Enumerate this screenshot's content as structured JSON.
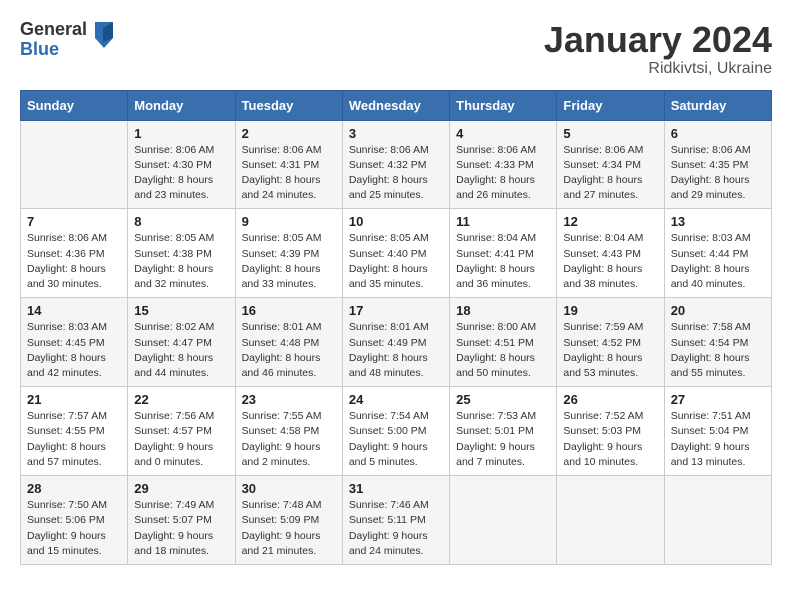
{
  "header": {
    "logo_general": "General",
    "logo_blue": "Blue",
    "title": "January 2024",
    "subtitle": "Ridkivtsi, Ukraine"
  },
  "days_of_week": [
    "Sunday",
    "Monday",
    "Tuesday",
    "Wednesday",
    "Thursday",
    "Friday",
    "Saturday"
  ],
  "weeks": [
    [
      {
        "day": "",
        "sunrise": "",
        "sunset": "",
        "daylight": ""
      },
      {
        "day": "1",
        "sunrise": "Sunrise: 8:06 AM",
        "sunset": "Sunset: 4:30 PM",
        "daylight": "Daylight: 8 hours and 23 minutes."
      },
      {
        "day": "2",
        "sunrise": "Sunrise: 8:06 AM",
        "sunset": "Sunset: 4:31 PM",
        "daylight": "Daylight: 8 hours and 24 minutes."
      },
      {
        "day": "3",
        "sunrise": "Sunrise: 8:06 AM",
        "sunset": "Sunset: 4:32 PM",
        "daylight": "Daylight: 8 hours and 25 minutes."
      },
      {
        "day": "4",
        "sunrise": "Sunrise: 8:06 AM",
        "sunset": "Sunset: 4:33 PM",
        "daylight": "Daylight: 8 hours and 26 minutes."
      },
      {
        "day": "5",
        "sunrise": "Sunrise: 8:06 AM",
        "sunset": "Sunset: 4:34 PM",
        "daylight": "Daylight: 8 hours and 27 minutes."
      },
      {
        "day": "6",
        "sunrise": "Sunrise: 8:06 AM",
        "sunset": "Sunset: 4:35 PM",
        "daylight": "Daylight: 8 hours and 29 minutes."
      }
    ],
    [
      {
        "day": "7",
        "sunrise": "Sunrise: 8:06 AM",
        "sunset": "Sunset: 4:36 PM",
        "daylight": "Daylight: 8 hours and 30 minutes."
      },
      {
        "day": "8",
        "sunrise": "Sunrise: 8:05 AM",
        "sunset": "Sunset: 4:38 PM",
        "daylight": "Daylight: 8 hours and 32 minutes."
      },
      {
        "day": "9",
        "sunrise": "Sunrise: 8:05 AM",
        "sunset": "Sunset: 4:39 PM",
        "daylight": "Daylight: 8 hours and 33 minutes."
      },
      {
        "day": "10",
        "sunrise": "Sunrise: 8:05 AM",
        "sunset": "Sunset: 4:40 PM",
        "daylight": "Daylight: 8 hours and 35 minutes."
      },
      {
        "day": "11",
        "sunrise": "Sunrise: 8:04 AM",
        "sunset": "Sunset: 4:41 PM",
        "daylight": "Daylight: 8 hours and 36 minutes."
      },
      {
        "day": "12",
        "sunrise": "Sunrise: 8:04 AM",
        "sunset": "Sunset: 4:43 PM",
        "daylight": "Daylight: 8 hours and 38 minutes."
      },
      {
        "day": "13",
        "sunrise": "Sunrise: 8:03 AM",
        "sunset": "Sunset: 4:44 PM",
        "daylight": "Daylight: 8 hours and 40 minutes."
      }
    ],
    [
      {
        "day": "14",
        "sunrise": "Sunrise: 8:03 AM",
        "sunset": "Sunset: 4:45 PM",
        "daylight": "Daylight: 8 hours and 42 minutes."
      },
      {
        "day": "15",
        "sunrise": "Sunrise: 8:02 AM",
        "sunset": "Sunset: 4:47 PM",
        "daylight": "Daylight: 8 hours and 44 minutes."
      },
      {
        "day": "16",
        "sunrise": "Sunrise: 8:01 AM",
        "sunset": "Sunset: 4:48 PM",
        "daylight": "Daylight: 8 hours and 46 minutes."
      },
      {
        "day": "17",
        "sunrise": "Sunrise: 8:01 AM",
        "sunset": "Sunset: 4:49 PM",
        "daylight": "Daylight: 8 hours and 48 minutes."
      },
      {
        "day": "18",
        "sunrise": "Sunrise: 8:00 AM",
        "sunset": "Sunset: 4:51 PM",
        "daylight": "Daylight: 8 hours and 50 minutes."
      },
      {
        "day": "19",
        "sunrise": "Sunrise: 7:59 AM",
        "sunset": "Sunset: 4:52 PM",
        "daylight": "Daylight: 8 hours and 53 minutes."
      },
      {
        "day": "20",
        "sunrise": "Sunrise: 7:58 AM",
        "sunset": "Sunset: 4:54 PM",
        "daylight": "Daylight: 8 hours and 55 minutes."
      }
    ],
    [
      {
        "day": "21",
        "sunrise": "Sunrise: 7:57 AM",
        "sunset": "Sunset: 4:55 PM",
        "daylight": "Daylight: 8 hours and 57 minutes."
      },
      {
        "day": "22",
        "sunrise": "Sunrise: 7:56 AM",
        "sunset": "Sunset: 4:57 PM",
        "daylight": "Daylight: 9 hours and 0 minutes."
      },
      {
        "day": "23",
        "sunrise": "Sunrise: 7:55 AM",
        "sunset": "Sunset: 4:58 PM",
        "daylight": "Daylight: 9 hours and 2 minutes."
      },
      {
        "day": "24",
        "sunrise": "Sunrise: 7:54 AM",
        "sunset": "Sunset: 5:00 PM",
        "daylight": "Daylight: 9 hours and 5 minutes."
      },
      {
        "day": "25",
        "sunrise": "Sunrise: 7:53 AM",
        "sunset": "Sunset: 5:01 PM",
        "daylight": "Daylight: 9 hours and 7 minutes."
      },
      {
        "day": "26",
        "sunrise": "Sunrise: 7:52 AM",
        "sunset": "Sunset: 5:03 PM",
        "daylight": "Daylight: 9 hours and 10 minutes."
      },
      {
        "day": "27",
        "sunrise": "Sunrise: 7:51 AM",
        "sunset": "Sunset: 5:04 PM",
        "daylight": "Daylight: 9 hours and 13 minutes."
      }
    ],
    [
      {
        "day": "28",
        "sunrise": "Sunrise: 7:50 AM",
        "sunset": "Sunset: 5:06 PM",
        "daylight": "Daylight: 9 hours and 15 minutes."
      },
      {
        "day": "29",
        "sunrise": "Sunrise: 7:49 AM",
        "sunset": "Sunset: 5:07 PM",
        "daylight": "Daylight: 9 hours and 18 minutes."
      },
      {
        "day": "30",
        "sunrise": "Sunrise: 7:48 AM",
        "sunset": "Sunset: 5:09 PM",
        "daylight": "Daylight: 9 hours and 21 minutes."
      },
      {
        "day": "31",
        "sunrise": "Sunrise: 7:46 AM",
        "sunset": "Sunset: 5:11 PM",
        "daylight": "Daylight: 9 hours and 24 minutes."
      },
      {
        "day": "",
        "sunrise": "",
        "sunset": "",
        "daylight": ""
      },
      {
        "day": "",
        "sunrise": "",
        "sunset": "",
        "daylight": ""
      },
      {
        "day": "",
        "sunrise": "",
        "sunset": "",
        "daylight": ""
      }
    ]
  ]
}
